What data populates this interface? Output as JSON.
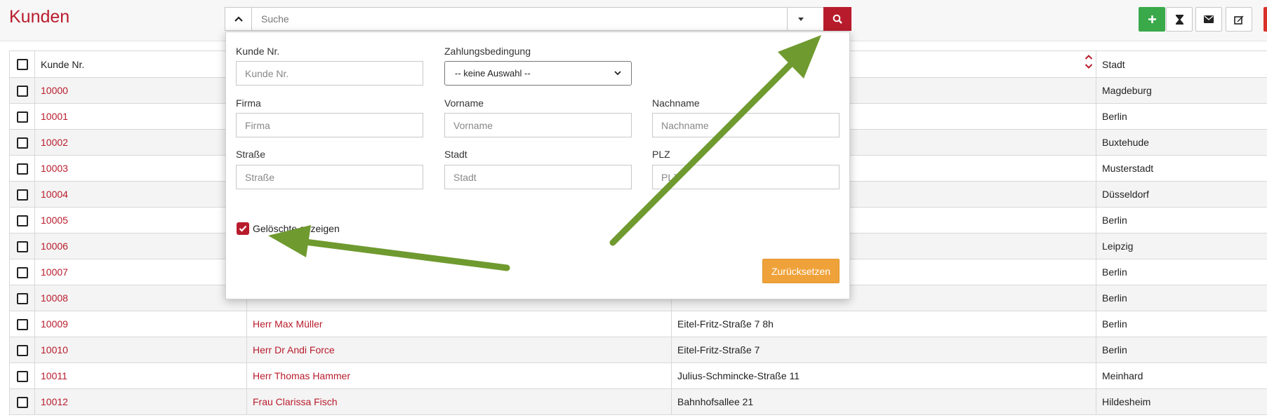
{
  "header": {
    "title": "Kunden"
  },
  "search": {
    "placeholder": "Suche"
  },
  "table": {
    "columns": [
      "Kunde Nr.",
      "Stadt"
    ],
    "rows": [
      {
        "nr": "10000",
        "name": "",
        "street": "",
        "city": "Magdeburg"
      },
      {
        "nr": "10001",
        "name": "",
        "street": "",
        "city": "Berlin"
      },
      {
        "nr": "10002",
        "name": "",
        "street": "",
        "city": "Buxtehude"
      },
      {
        "nr": "10003",
        "name": "",
        "street": "",
        "city": "Musterstadt"
      },
      {
        "nr": "10004",
        "name": "",
        "street": "",
        "city": "Düsseldorf"
      },
      {
        "nr": "10005",
        "name": "",
        "street": "",
        "city": "Berlin"
      },
      {
        "nr": "10006",
        "name": "",
        "street": "",
        "city": "Leipzig"
      },
      {
        "nr": "10007",
        "name": "",
        "street": "",
        "city": "Berlin"
      },
      {
        "nr": "10008",
        "name": "",
        "street": "",
        "city": "Berlin"
      },
      {
        "nr": "10009",
        "name": "Herr Max Müller",
        "street": "Eitel-Fritz-Straße 7 8h",
        "city": "Berlin"
      },
      {
        "nr": "10010",
        "name": "Herr Dr Andi Force",
        "street": "Eitel-Fritz-Straße 7",
        "city": "Berlin"
      },
      {
        "nr": "10011",
        "name": "Herr Thomas Hammer",
        "street": "Julius-Schmincke-Straße 11",
        "city": "Meinhard"
      },
      {
        "nr": "10012",
        "name": "Frau Clarissa Fisch",
        "street": "Bahnhofsallee 21",
        "city": "Hildesheim"
      }
    ]
  },
  "filter": {
    "kunde_nr": {
      "label": "Kunde Nr.",
      "placeholder": "Kunde Nr."
    },
    "zahlung": {
      "label": "Zahlungsbedingung",
      "value": "-- keine Auswahl --"
    },
    "firma": {
      "label": "Firma",
      "placeholder": "Firma"
    },
    "vorname": {
      "label": "Vorname",
      "placeholder": "Vorname"
    },
    "nachname": {
      "label": "Nachname",
      "placeholder": "Nachname"
    },
    "strasse": {
      "label": "Straße",
      "placeholder": "Straße"
    },
    "stadt": {
      "label": "Stadt",
      "placeholder": "Stadt"
    },
    "plz": {
      "label": "PLZ",
      "placeholder": "PLZ"
    },
    "show_deleted": {
      "label": "Gelöschte anzeigen",
      "checked": true
    },
    "reset_label": "Zurücksetzen"
  },
  "colors": {
    "accent": "#b81c2c",
    "add_button": "#3aa94a",
    "delete_button": "#d9312a",
    "reset_button": "#f0a23a",
    "annotation_arrow": "#6f9a2f"
  },
  "icons": {
    "toggle": "chevron-up-icon",
    "dropdown": "caret-down-icon",
    "search": "search-icon",
    "add": "plus-icon",
    "history": "hourglass-icon",
    "mail": "envelope-icon",
    "edit": "edit-icon",
    "delete": "trash-icon"
  }
}
